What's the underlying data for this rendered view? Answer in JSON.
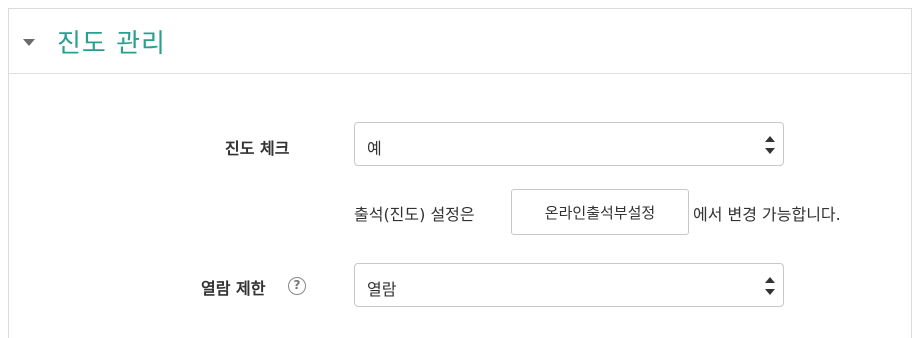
{
  "section": {
    "title": "진도 관리"
  },
  "progress_check": {
    "label": "진도 체크",
    "value": "예"
  },
  "attendance_note": {
    "before": "출석(진도) 설정은",
    "button_label": "온라인출석부설정",
    "after": "에서 변경 가능합니다."
  },
  "view_restriction": {
    "label": "열람 제한",
    "help_icon": "?",
    "value": "열람"
  }
}
